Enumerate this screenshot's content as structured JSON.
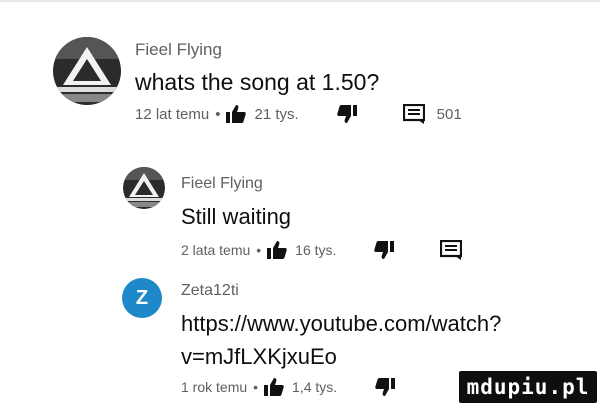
{
  "comments": [
    {
      "author": "Fieel Flying",
      "text_lines": [
        "whats the song at 1.50?"
      ],
      "time": "12 lat temu",
      "likes": "21 tys.",
      "replies": "501",
      "avatar_icon": "triangle-logo-avatar"
    },
    {
      "author": "Fieel Flying",
      "text_lines": [
        "Still waiting"
      ],
      "time": "2 lata temu",
      "likes": "16 tys.",
      "replies": "",
      "avatar_icon": "triangle-logo-avatar"
    },
    {
      "author": "Zeta12ti",
      "avatar_letter": "Z",
      "text_lines": [
        "https://www.youtube.com/watch?",
        "v=mJfLXKjxuEo"
      ],
      "time": "1 rok temu",
      "likes": "1,4 tys.",
      "replies": "",
      "avatar_color": "#1e88c8"
    }
  ],
  "separator": "•",
  "watermark": "mdupiu.pl",
  "icons": {
    "like": "thumbs-up-icon",
    "dislike": "thumbs-down-icon",
    "reply": "comment-icon"
  }
}
